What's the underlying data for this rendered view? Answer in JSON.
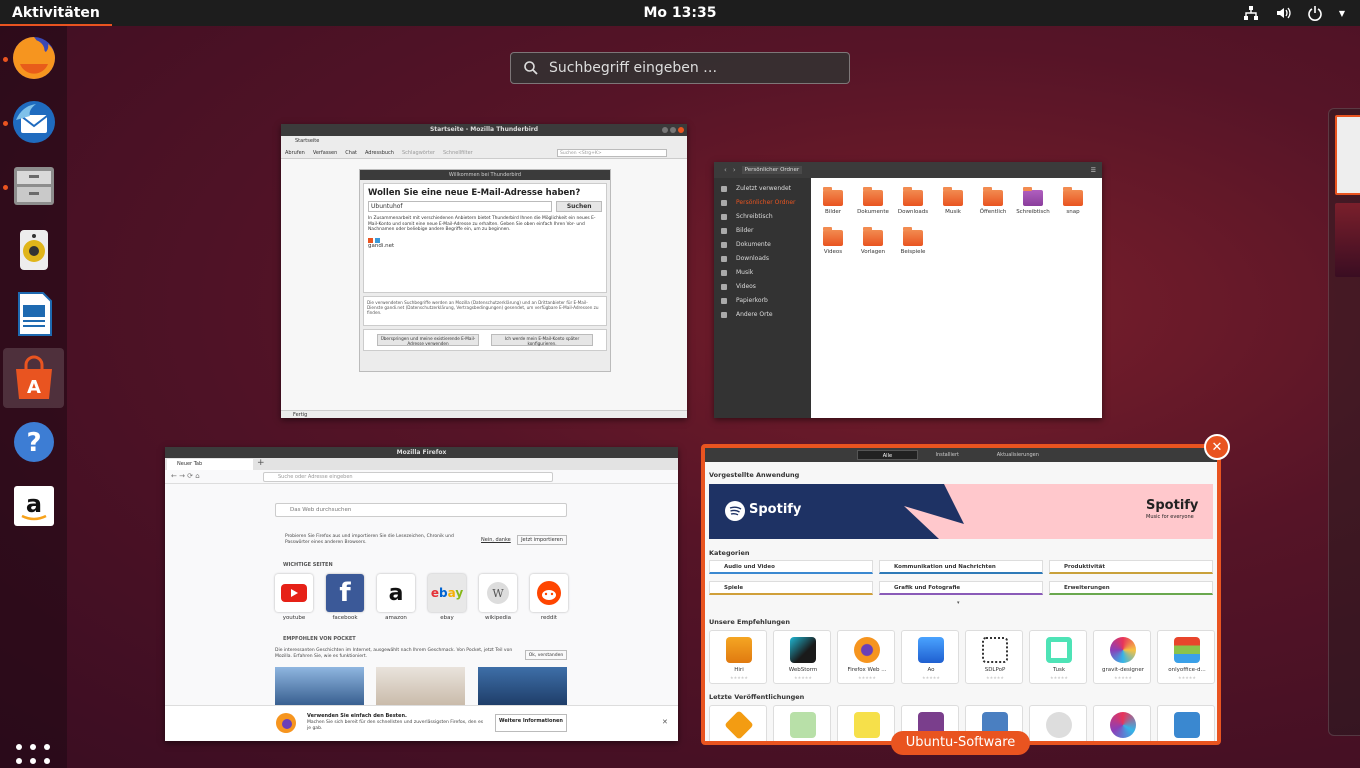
{
  "topbar": {
    "activities": "Aktivitäten",
    "clock": "Mo 13:35"
  },
  "search": {
    "placeholder": "Suchbegriff eingeben …"
  },
  "dock": {
    "items": [
      "firefox-icon",
      "thunderbird-icon",
      "files-icon",
      "rhythmbox-icon",
      "writer-icon",
      "software-icon",
      "help-icon",
      "amazon-icon"
    ]
  },
  "thunderbird": {
    "title": "Startseite - Mozilla Thunderbird",
    "tab": "Startseite",
    "toolbar": [
      "Abrufen",
      "Verfassen",
      "Chat",
      "Adressbuch",
      "Schlagwörter",
      "Schnellfilter"
    ],
    "search_placeholder": "Suchen <Strg+K>",
    "dialog_title": "Willkommen bei Thunderbird",
    "dialog_heading": "Wollen Sie eine neue E-Mail-Adresse haben?",
    "input_value": "Ubuntuhof",
    "search_button": "Suchen",
    "dialog_text": "In Zusammenarbeit mit verschiedenen Anbietern bietet Thunderbird Ihnen die Möglichkeit ein neues E-Mail-Konto und somit eine neue E-Mail-Adresse zu erhalten. Geben Sie oben einfach Ihren Vor- und Nachnamen oder beliebige andere Begriffe ein, um zu beginnen.",
    "provider": "gandi.net",
    "footer_text": "Die verwendeten Suchbegriffe werden an Mozilla (Datenschutzerklärung) und an Drittanbieter für E-Mail-Dienste gandi.net (Datenschutzerklärung, Vertragsbedingungen) gesendet, um verfügbare E-Mail-Adressen zu finden.",
    "button_skip": "Überspringen und meine existierende E-Mail-Adresse verwenden",
    "button_later": "Ich werde mein E-Mail-Konto später konfigurieren.",
    "status": "Fertig"
  },
  "files": {
    "path": "Persönlicher Ordner",
    "sidebar": [
      "Zuletzt verwendet",
      "Persönlicher Ordner",
      "Schreibtisch",
      "Bilder",
      "Dokumente",
      "Downloads",
      "Musik",
      "Videos",
      "Papierkorb",
      "Andere Orte"
    ],
    "folders": [
      "Bilder",
      "Dokumente",
      "Downloads",
      "Musik",
      "Öffentlich",
      "Schreibtisch",
      "snap",
      "Videos",
      "Vorlagen",
      "Beispiele"
    ]
  },
  "firefox": {
    "title": "Mozilla Firefox",
    "tab": "Neuer Tab",
    "url_placeholder": "Suche oder Adresse eingeben",
    "search_placeholder": "Das Web durchsuchen",
    "import_text": "Probieren Sie Firefox aus und importieren Sie die Lesezeichen, Chronik und Passwörter eines anderen Browsers.",
    "import_no": "Nein, danke",
    "import_yes": "Jetzt importieren",
    "top_sites_heading": "WICHTIGE SEITEN",
    "top_sites": [
      "youtube",
      "facebook",
      "amazon",
      "ebay",
      "wikipedia",
      "reddit"
    ],
    "pocket_heading": "EMPFOHLEN VON POCKET",
    "pocket_text": "Die interessanten Geschichten im Internet, ausgewählt nach Ihrem Geschmack. Von Pocket, jetzt Teil von Mozilla. Erfahren Sie, wie es funktioniert.",
    "pocket_ok": "Ok, verstanden",
    "banner_title": "Verwenden Sie einfach den Besten.",
    "banner_text": "Machen Sie sich bereit für den schnellsten und zuverlässigsten Firefox, den es je gab.",
    "banner_button": "Weitere Informationen"
  },
  "software": {
    "tabs": [
      "Alle",
      "Installiert",
      "Aktualisierungen"
    ],
    "featured_heading": "Vorgestellte Anwendung",
    "banner_name": "Spotify",
    "banner_tagline": "Music for everyone",
    "categories_heading": "Kategorien",
    "categories": [
      "Audio und Video",
      "Kommunikation und Nachrichten",
      "Produktivität",
      "Spiele",
      "Grafik und Fotografie",
      "Erweiterungen"
    ],
    "recommend_heading": "Unsere Empfehlungen",
    "apps": [
      "Hiri",
      "WebStorm",
      "Firefox Web ...",
      "Ao",
      "SDLPoP",
      "Tusk",
      "gravit-designer",
      "onlyoffice-d..."
    ],
    "recent_heading": "Letzte Veröffentlichungen",
    "label": "Ubuntu-Software"
  }
}
